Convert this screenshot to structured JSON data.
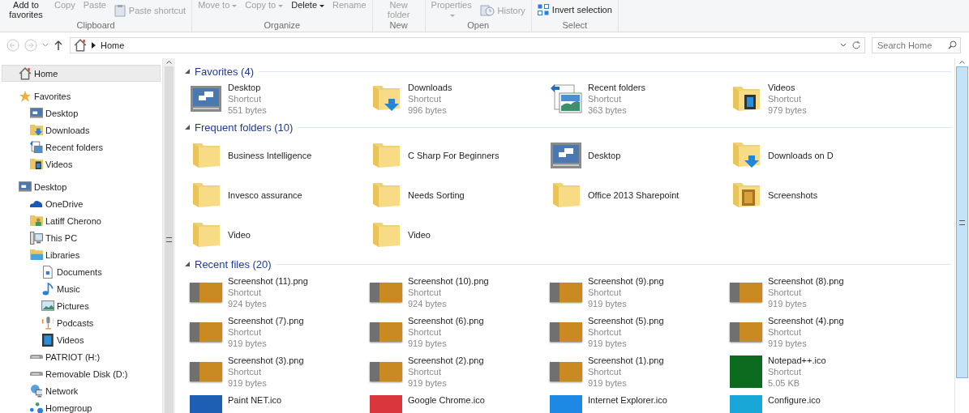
{
  "ribbon": {
    "groups": [
      {
        "label": "Clipboard",
        "buttons": [
          {
            "label": "Add to favorites",
            "kind": "large",
            "disabled": false,
            "caret": false
          },
          {
            "label": "Copy",
            "kind": "large",
            "disabled": true,
            "caret": false
          },
          {
            "label": "Paste",
            "kind": "large",
            "disabled": true,
            "caret": false
          },
          {
            "label": "Paste shortcut",
            "kind": "clipboard",
            "disabled": true,
            "caret": false
          }
        ]
      },
      {
        "label": "Organize",
        "buttons": [
          {
            "label": "Move to",
            "kind": "large",
            "disabled": true,
            "caret": true
          },
          {
            "label": "Copy to",
            "kind": "large",
            "disabled": true,
            "caret": true
          },
          {
            "label": "Delete",
            "kind": "large",
            "disabled": false,
            "caret": true
          },
          {
            "label": "Rename",
            "kind": "large",
            "disabled": true,
            "caret": false
          }
        ]
      },
      {
        "label": "New",
        "buttons": [
          {
            "label": "New folder",
            "kind": "large",
            "disabled": true,
            "caret": false
          }
        ]
      },
      {
        "label": "Open",
        "buttons": [
          {
            "label": "Properties",
            "kind": "large",
            "disabled": true,
            "caret": true
          },
          {
            "label": "History",
            "kind": "clock",
            "disabled": true,
            "caret": false
          }
        ]
      },
      {
        "label": "Select",
        "buttons": [
          {
            "label": "Invert selection",
            "kind": "squares",
            "disabled": false,
            "caret": false
          }
        ]
      }
    ]
  },
  "address_bar": {
    "path": [
      "Home"
    ],
    "search": {
      "placeholder": "Search Home"
    }
  },
  "sidebar": {
    "sections": [
      {
        "label": "Home",
        "kind": "house",
        "selected": true
      },
      {
        "label": "Favorites",
        "kind": "star",
        "selected": false,
        "children": [
          {
            "label": "Desktop",
            "kind": "monitor",
            "selected": false
          },
          {
            "label": "Downloads",
            "kind": "download-folder",
            "selected": false
          },
          {
            "label": "Recent folders",
            "kind": "recent-folders",
            "selected": false
          },
          {
            "label": "Videos",
            "kind": "video-folder",
            "selected": false
          }
        ]
      },
      {
        "label": "Desktop",
        "kind": "monitor",
        "selected": false,
        "children": [
          {
            "label": "OneDrive",
            "kind": "cloud",
            "selected": false
          },
          {
            "label": "Latiff Cherono",
            "kind": "user-folder",
            "selected": false
          },
          {
            "label": "This PC",
            "kind": "computer",
            "selected": false
          },
          {
            "label": "Libraries",
            "kind": "library-folder",
            "selected": false,
            "children": [
              {
                "label": "Documents",
                "kind": "document",
                "selected": false
              },
              {
                "label": "Music",
                "kind": "music-note",
                "selected": false
              },
              {
                "label": "Pictures",
                "kind": "picture",
                "selected": false
              },
              {
                "label": "Podcasts",
                "kind": "microphone",
                "selected": false
              },
              {
                "label": "Videos",
                "kind": "film",
                "selected": false
              }
            ]
          },
          {
            "label": "PATRIOT (H:)",
            "kind": "drive",
            "selected": false
          },
          {
            "label": "Removable Disk (D:)",
            "kind": "drive",
            "selected": false
          },
          {
            "label": "Network",
            "kind": "network",
            "selected": false
          },
          {
            "label": "Homegroup",
            "kind": "homegroup",
            "selected": false
          }
        ]
      }
    ]
  },
  "groups": [
    {
      "title": "Favorites (4)",
      "expanded": true,
      "kind": "details",
      "items": [
        {
          "name": "Desktop",
          "type": "Shortcut",
          "size": "551 bytes",
          "kind": "monitor"
        },
        {
          "name": "Downloads",
          "type": "Shortcut",
          "size": "996 bytes",
          "kind": "download-folder"
        },
        {
          "name": "Recent folders",
          "type": "Shortcut",
          "size": "363 bytes",
          "kind": "recent-folders"
        },
        {
          "name": "Videos",
          "type": "Shortcut",
          "size": "979 bytes",
          "kind": "video-folder"
        }
      ]
    },
    {
      "title": "Frequent folders (10)",
      "expanded": true,
      "kind": "names",
      "items": [
        {
          "name": "Business Intelligence",
          "kind": "folder"
        },
        {
          "name": "C Sharp For Beginners",
          "kind": "folder"
        },
        {
          "name": "Desktop",
          "kind": "monitor"
        },
        {
          "name": "Downloads on D",
          "kind": "download-folder"
        },
        {
          "name": "Invesco assurance",
          "kind": "folder"
        },
        {
          "name": "Needs Sorting",
          "kind": "folder"
        },
        {
          "name": "Office 2013 Sharepoint",
          "kind": "folder"
        },
        {
          "name": "Screenshots",
          "kind": "picture-folder"
        },
        {
          "name": "Video",
          "kind": "folder"
        },
        {
          "name": "Video",
          "kind": "folder"
        }
      ]
    },
    {
      "title": "Recent files (20)",
      "expanded": true,
      "kind": "details",
      "items": [
        {
          "name": "Screenshot (11).png",
          "type": "Shortcut",
          "size": "924 bytes",
          "kind": "thumbnail"
        },
        {
          "name": "Screenshot (10).png",
          "type": "Shortcut",
          "size": "924 bytes",
          "kind": "thumbnail"
        },
        {
          "name": "Screenshot (9).png",
          "type": "Shortcut",
          "size": "919 bytes",
          "kind": "thumbnail"
        },
        {
          "name": "Screenshot (8).png",
          "type": "Shortcut",
          "size": "919 bytes",
          "kind": "thumbnail"
        },
        {
          "name": "Screenshot (7).png",
          "type": "Shortcut",
          "size": "919 bytes",
          "kind": "thumbnail"
        },
        {
          "name": "Screenshot (6).png",
          "type": "Shortcut",
          "size": "919 bytes",
          "kind": "thumbnail"
        },
        {
          "name": "Screenshot (5).png",
          "type": "Shortcut",
          "size": "919 bytes",
          "kind": "thumbnail"
        },
        {
          "name": "Screenshot (4).png",
          "type": "Shortcut",
          "size": "919 bytes",
          "kind": "thumbnail"
        },
        {
          "name": "Screenshot (3).png",
          "type": "Shortcut",
          "size": "919 bytes",
          "kind": "thumbnail"
        },
        {
          "name": "Screenshot (2).png",
          "type": "Shortcut",
          "size": "919 bytes",
          "kind": "thumbnail"
        },
        {
          "name": "Screenshot (1).png",
          "type": "Shortcut",
          "size": "919 bytes",
          "kind": "thumbnail"
        },
        {
          "name": "Notepad++.ico",
          "type": "Shortcut",
          "size": "5.05 KB",
          "kind": "tile",
          "color": "#0b6a1e"
        },
        {
          "name": "Paint NET.ico",
          "kind": "tile",
          "color": "#1e5fb4"
        },
        {
          "name": "Google Chrome.ico",
          "kind": "tile",
          "color": "#d9363e"
        },
        {
          "name": "Internet Explorer.ico",
          "kind": "tile",
          "color": "#1e88e5"
        },
        {
          "name": "Configure.ico",
          "kind": "tile",
          "color": "#18a7d6"
        }
      ]
    }
  ]
}
